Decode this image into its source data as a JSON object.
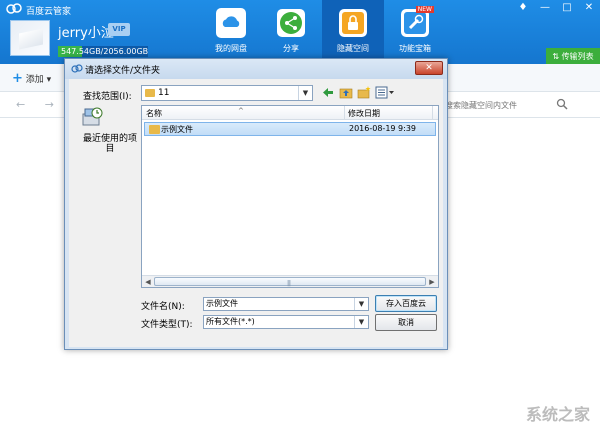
{
  "app": {
    "title": "百度云管家",
    "username": "jerry小泣",
    "vip": "VIP",
    "quota": "547.54GB/2056.00GB",
    "quota_fraction": 0.266,
    "transfer_label": "传输列表",
    "window_buttons": [
      "♦",
      "—",
      "□",
      "✕"
    ]
  },
  "nav": {
    "tabs": [
      {
        "label": "我的网盘",
        "icon": "cloud-icon",
        "color": "#2c93e8"
      },
      {
        "label": "分享",
        "icon": "share-icon",
        "color": "#3cae3c"
      },
      {
        "label": "隐藏空间",
        "icon": "lock-icon",
        "color": "#f5a623",
        "active": true
      },
      {
        "label": "功能宝箱",
        "icon": "toolbox-icon",
        "color": "#2c93e8",
        "badge": "NEW"
      }
    ]
  },
  "toolbar": {
    "add_label": "添加"
  },
  "addressbar": {
    "search_placeholder": "搜索隐藏空间内文件"
  },
  "dialog": {
    "title": "请选择文件/文件夹",
    "close": "✕",
    "lookin_label": "查找范围(I):",
    "lookin_value": "11",
    "places": [
      {
        "label": "最近使用的项目"
      }
    ],
    "columns": {
      "name": "名称",
      "date": "修改日期"
    },
    "files": [
      {
        "name": "示例文件",
        "date": "2016-08-19 9:39"
      }
    ],
    "filename_label": "文件名(N):",
    "filename_value": "示例文件",
    "filetype_label": "文件类型(T):",
    "filetype_value": "所有文件(*.*)",
    "save_button": "存入百度云",
    "cancel_button": "取消"
  },
  "watermark": "系统之家"
}
